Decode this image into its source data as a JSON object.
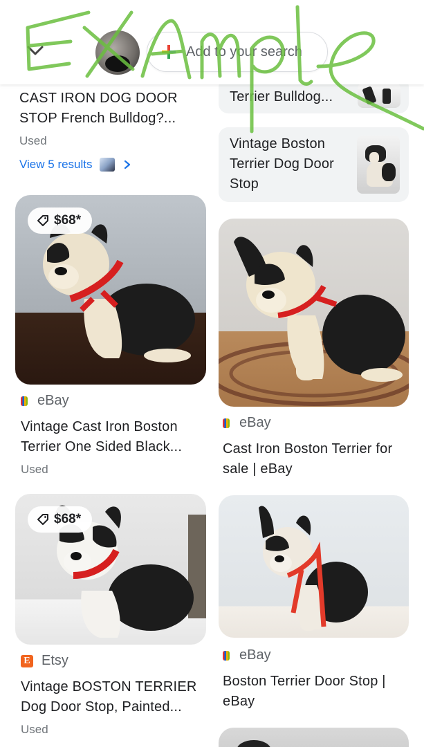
{
  "header": {
    "add_search_label": "Add to your search"
  },
  "watermark_text": "Example",
  "colors": {
    "link": "#1a73e8",
    "etsy": "#f1641e",
    "chip_bg": "#f1f3f4",
    "muted": "#70757a"
  },
  "top_left": {
    "title_lines": [
      "CAST IRON DOG DOOR",
      "STOP French Bulldog?..."
    ],
    "condition": "Used",
    "view_results": "View 5 results"
  },
  "top_right": {
    "partial_title": "Terrier Bulldog...",
    "chip_title_lines": [
      "Vintage Boston",
      "Terrier Dog Door",
      "Stop"
    ]
  },
  "cards": [
    {
      "price": "$68*",
      "source": "eBay",
      "title_lines": [
        "Vintage Cast Iron Boston",
        "Terrier One Sided Black..."
      ],
      "condition": "Used"
    },
    {
      "source": "eBay",
      "title_lines": [
        "Cast Iron Boston Terrier for",
        "sale | eBay"
      ]
    },
    {
      "price": "$68*",
      "source": "Etsy",
      "title_lines": [
        "Vintage BOSTON TERRIER",
        "Dog Door Stop, Painted..."
      ],
      "condition": "Used"
    },
    {
      "source": "eBay",
      "title_lines": [
        "Boston Terrier Door Stop |",
        "eBay"
      ]
    }
  ]
}
